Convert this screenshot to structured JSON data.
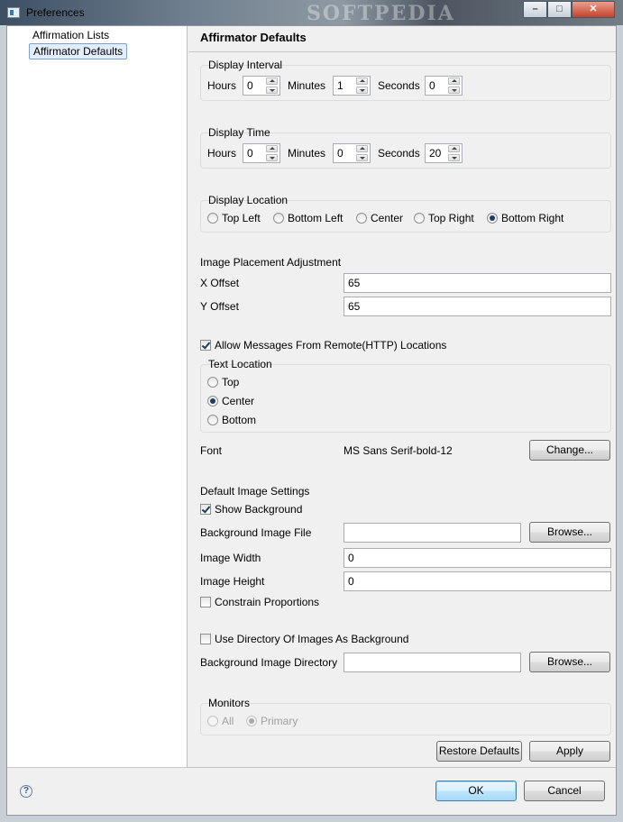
{
  "window": {
    "title": "Preferences",
    "watermark": "SOFTPEDIA",
    "minimize_glyph": "–",
    "maximize_glyph": "□",
    "close_glyph": "✕"
  },
  "tree": {
    "items": [
      {
        "label": "Affirmation Lists",
        "selected": false
      },
      {
        "label": "Affirmator Defaults",
        "selected": true
      }
    ]
  },
  "page": {
    "title": "Affirmator Defaults",
    "display_interval": {
      "legend": "Display Interval",
      "hours_label": "Hours",
      "hours": "0",
      "minutes_label": "Minutes",
      "minutes": "1",
      "seconds_label": "Seconds",
      "seconds": "0"
    },
    "display_time": {
      "legend": "Display Time",
      "hours_label": "Hours",
      "hours": "0",
      "minutes_label": "Minutes",
      "minutes": "0",
      "seconds_label": "Seconds",
      "seconds": "20"
    },
    "display_location": {
      "legend": "Display Location",
      "options": [
        "Top Left",
        "Bottom Left",
        "Center",
        "Top Right",
        "Bottom Right"
      ],
      "selected": "Bottom Right"
    },
    "image_placement": {
      "heading": "Image Placement Adjustment",
      "x_label": "X Offset",
      "x_value": "65",
      "y_label": "Y Offset",
      "y_value": "65"
    },
    "allow_remote": {
      "label": "Allow Messages From Remote(HTTP) Locations",
      "checked": true
    },
    "text_location": {
      "legend": "Text Location",
      "options": [
        "Top",
        "Center",
        "Bottom"
      ],
      "selected": "Center"
    },
    "font": {
      "label": "Font",
      "value": "MS Sans Serif-bold-12",
      "change_label": "Change..."
    },
    "default_image": {
      "heading": "Default Image Settings",
      "show_background_label": "Show Background",
      "show_background": true,
      "bg_file_label": "Background Image File",
      "bg_file_value": "",
      "browse_label": "Browse...",
      "width_label": "Image Width",
      "width_value": "0",
      "height_label": "Image Height",
      "height_value": "0",
      "constrain_label": "Constrain Proportions",
      "constrain": false
    },
    "directory": {
      "use_dir_label": "Use Directory Of Images As Background",
      "use_dir": false,
      "dir_label": "Background Image Directory",
      "dir_value": "",
      "browse_label": "Browse..."
    },
    "monitors": {
      "legend": "Monitors",
      "options": [
        "All",
        "Primary"
      ],
      "selected": "Primary",
      "enabled": false
    },
    "restore_defaults_label": "Restore Defaults",
    "apply_label": "Apply"
  },
  "footer": {
    "help_glyph": "?",
    "ok_label": "OK",
    "cancel_label": "Cancel"
  }
}
